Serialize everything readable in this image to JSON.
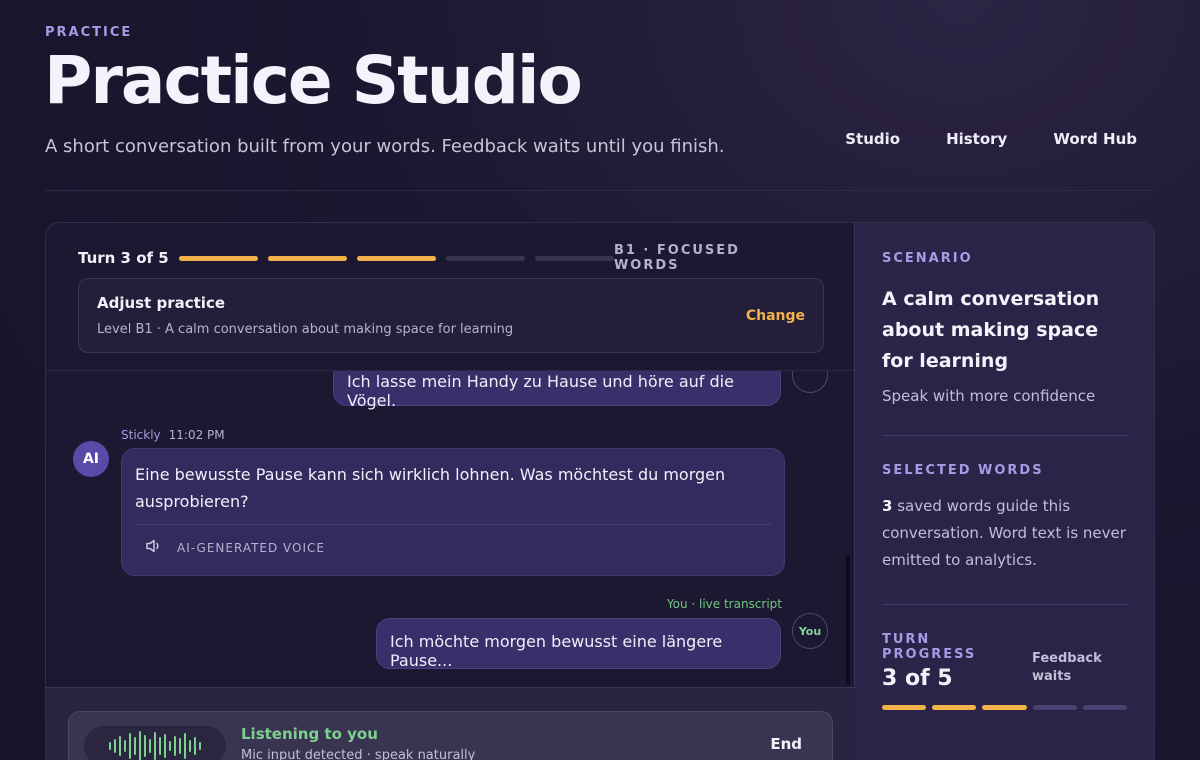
{
  "header": {
    "eyebrow": "PRACTICE",
    "title": "Practice Studio",
    "subtitle": "A short conversation built from your words. Feedback waits until you finish."
  },
  "nav": [
    {
      "label": "Studio"
    },
    {
      "label": "History"
    },
    {
      "label": "Word Hub"
    }
  ],
  "session": {
    "turn_label": "Turn 3 of 5",
    "turns_total": 5,
    "turns_done": 3,
    "level_tag": "B1 · FOCUSED WORDS"
  },
  "adjust": {
    "title": "Adjust practice",
    "subtitle": "Level B1 · A calm conversation about making space for learning",
    "change_label": "Change"
  },
  "messages": {
    "prev_user": "Ich lasse mein Handy zu Hause und höre auf die Vögel.",
    "ai_avatar": "AI",
    "ai_name": "Stickly",
    "ai_time": "11:02 PM",
    "ai_text": "Eine bewusste Pause kann sich wirklich lohnen. Was möchtest du morgen ausprobieren?",
    "voice_label": "AI-GENERATED VOICE",
    "you_meta": "You · live transcript",
    "live_user": "Ich möchte morgen bewusst eine längere Pause...",
    "you_badge": "You"
  },
  "listening": {
    "title": "Listening to you",
    "subtitle": "Mic input detected · speak naturally",
    "end_label": "End"
  },
  "sidebar": {
    "scenario_label": "SCENARIO",
    "scenario_title": "A calm conversation about making space for learning",
    "scenario_sub": "Speak with more confidence",
    "words_label": "SELECTED WORDS",
    "words_count": "3",
    "words_text": "saved words guide this conversation. Word text is never emitted to analytics.",
    "progress_label": "TURN PROGRESS",
    "progress_value": "3 of 5",
    "feedback_note": "Feedback waits"
  },
  "colors": {
    "accent": "#f2b44a",
    "lavender": "#a79be6",
    "listening_green": "#7ed08f"
  }
}
